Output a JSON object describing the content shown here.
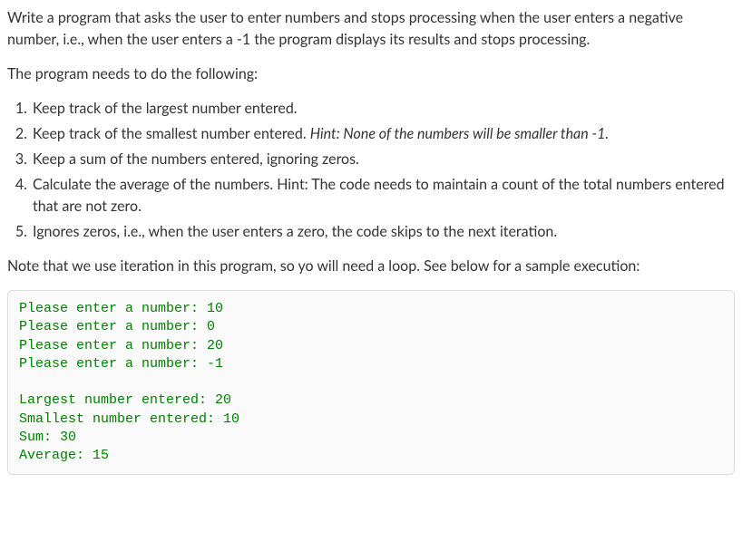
{
  "intro": "Write a program that asks the user to enter numbers and stops processing when the user enters a negative number, i.e., when the user enters a -1 the program displays its results and stops processing.",
  "needs": "The program needs to do the following:",
  "items": {
    "i1": "Keep track of the largest number entered.",
    "i2_pre": "Keep track of the smallest number entered. ",
    "i2_hint": "Hint: None of the numbers will be smaller than -1.",
    "i3": "Keep a sum of the numbers entered, ignoring zeros.",
    "i4": "Calculate the average of the numbers. Hint: The code needs to maintain a count of the total numbers entered that are not zero.",
    "i5": "Ignores zeros, i.e., when the user enters a zero, the code skips to the next iteration."
  },
  "note": "Note that we use iteration in this program, so yo will need a loop. See below for a sample execution:",
  "sample": "Please enter a number: 10\nPlease enter a number: 0\nPlease enter a number: 20\nPlease enter a number: -1\n\nLargest number entered: 20\nSmallest number entered: 10\nSum: 30\nAverage: 15"
}
